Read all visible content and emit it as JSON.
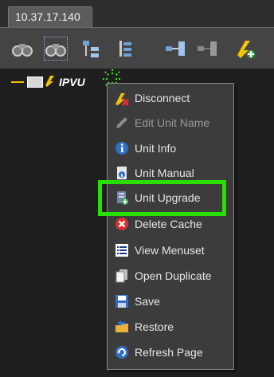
{
  "tab": {
    "title": "10.37.17.140"
  },
  "toolbar": {
    "tools": [
      {
        "icon": "binoculars-icon"
      },
      {
        "icon": "binoculars-selected-icon"
      },
      {
        "icon": "tree-expand-icon"
      },
      {
        "icon": "tree-collapse-icon"
      },
      {
        "icon": "connect-network-icon"
      },
      {
        "icon": "disconnect-network-icon"
      },
      {
        "icon": "add-unit-icon"
      }
    ]
  },
  "tree": {
    "node_label": "IPVU"
  },
  "menu": {
    "items": [
      {
        "label": "Disconnect",
        "icon": "disconnect-icon",
        "enabled": true
      },
      {
        "label": "Edit Unit Name",
        "icon": "pencil-icon",
        "enabled": false
      },
      {
        "label": "Unit Info",
        "icon": "info-icon",
        "enabled": true
      },
      {
        "label": "Unit Manual",
        "icon": "manual-icon",
        "enabled": true
      },
      {
        "label": "Unit Upgrade",
        "icon": "upgrade-icon",
        "enabled": true
      },
      {
        "label": "Delete Cache",
        "icon": "delete-icon",
        "enabled": true
      },
      {
        "label": "View Menuset",
        "icon": "list-icon",
        "enabled": true
      },
      {
        "label": "Open Duplicate",
        "icon": "duplicate-icon",
        "enabled": true
      },
      {
        "label": "Save",
        "icon": "save-icon",
        "enabled": true
      },
      {
        "label": "Restore",
        "icon": "restore-icon",
        "enabled": true
      },
      {
        "label": "Refresh Page",
        "icon": "refresh-icon",
        "enabled": true
      }
    ]
  },
  "colors": {
    "highlight": "#29e000",
    "menu_bg": "#3c3c3c",
    "tree_bg": "#1f1f1f"
  }
}
